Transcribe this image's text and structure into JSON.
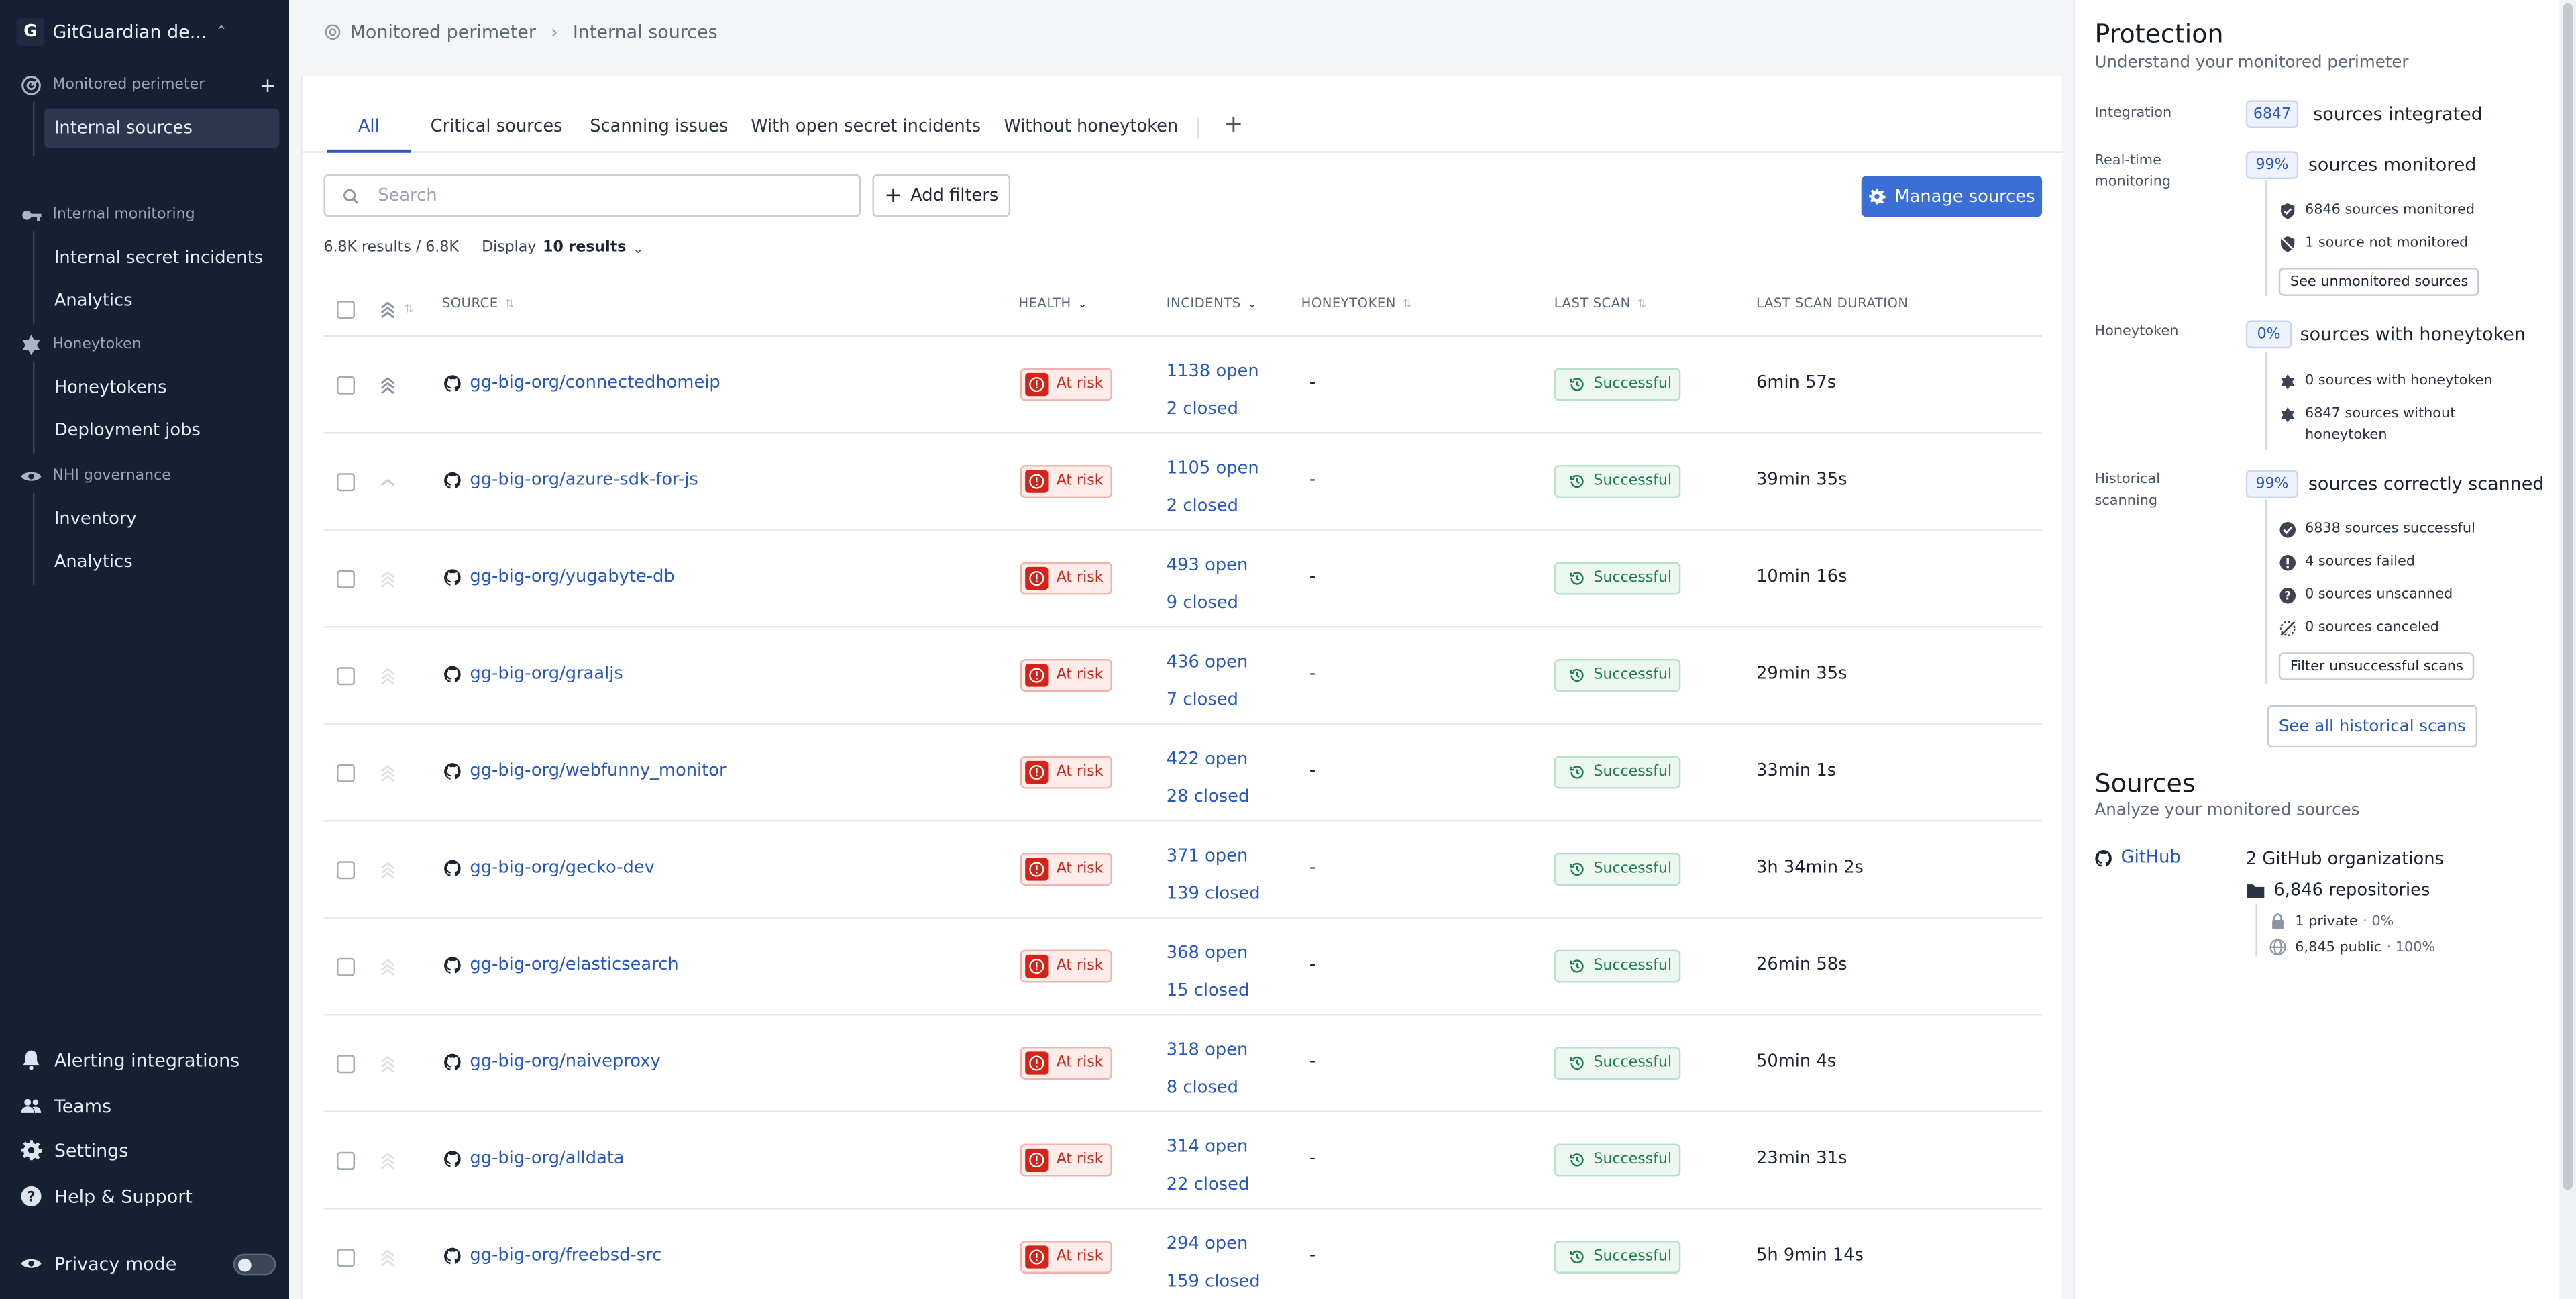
{
  "sidebar": {
    "org_initial": "G",
    "org_name": "GitGuardian de...",
    "sections": {
      "monitored": "Monitored perimeter",
      "internal": "Internal monitoring",
      "honeytoken": "Honeytoken",
      "nhi": "NHI governance"
    },
    "items": {
      "internal_sources": "Internal sources",
      "internal_secret_incidents": "Internal secret incidents",
      "analytics_1": "Analytics",
      "honeytokens": "Honeytokens",
      "deployment_jobs": "Deployment jobs",
      "inventory": "Inventory",
      "analytics_2": "Analytics"
    },
    "bottom": {
      "alerting": "Alerting integrations",
      "teams": "Teams",
      "settings": "Settings",
      "help": "Help & Support",
      "privacy": "Privacy mode"
    }
  },
  "breadcrumb": {
    "root": "Monitored perimeter",
    "current": "Internal sources"
  },
  "tabs": [
    "All",
    "Critical sources",
    "Scanning issues",
    "With open secret incidents",
    "Without honeytoken"
  ],
  "toolbar": {
    "search_placeholder": "Search",
    "add_filters": "Add filters",
    "manage_sources": "Manage sources"
  },
  "counts": {
    "results": "6.8K results",
    "total": "/ 6.8K",
    "display_label": "Display",
    "display_value": "10 results"
  },
  "columns": {
    "source": "SOURCE",
    "health": "HEALTH",
    "incidents": "INCIDENTS",
    "honeytoken": "HONEYTOKEN",
    "last_scan": "LAST SCAN",
    "last_scan_duration": "LAST SCAN DURATION"
  },
  "rows": [
    {
      "source": "gg-big-org/connectedhomeip",
      "health": "At risk",
      "open": "1138",
      "closed": "2",
      "honeytoken": "-",
      "last_scan": "Successful",
      "duration": "6min 57s"
    },
    {
      "source": "gg-big-org/azure-sdk-for-js",
      "health": "At risk",
      "open": "1105",
      "closed": "2",
      "honeytoken": "-",
      "last_scan": "Successful",
      "duration": "39min 35s"
    },
    {
      "source": "gg-big-org/yugabyte-db",
      "health": "At risk",
      "open": "493",
      "closed": "9",
      "honeytoken": "-",
      "last_scan": "Successful",
      "duration": "10min 16s"
    },
    {
      "source": "gg-big-org/graaljs",
      "health": "At risk",
      "open": "436",
      "closed": "7",
      "honeytoken": "-",
      "last_scan": "Successful",
      "duration": "29min 35s"
    },
    {
      "source": "gg-big-org/webfunny_monitor",
      "health": "At risk",
      "open": "422",
      "closed": "28",
      "honeytoken": "-",
      "last_scan": "Successful",
      "duration": "33min 1s"
    },
    {
      "source": "gg-big-org/gecko-dev",
      "health": "At risk",
      "open": "371",
      "closed": "139",
      "honeytoken": "-",
      "last_scan": "Successful",
      "duration": "3h 34min 2s"
    },
    {
      "source": "gg-big-org/elasticsearch",
      "health": "At risk",
      "open": "368",
      "closed": "15",
      "honeytoken": "-",
      "last_scan": "Successful",
      "duration": "26min 58s"
    },
    {
      "source": "gg-big-org/naiveproxy",
      "health": "At risk",
      "open": "318",
      "closed": "8",
      "honeytoken": "-",
      "last_scan": "Successful",
      "duration": "50min 4s"
    },
    {
      "source": "gg-big-org/alldata",
      "health": "At risk",
      "open": "314",
      "closed": "22",
      "honeytoken": "-",
      "last_scan": "Successful",
      "duration": "23min 31s"
    },
    {
      "source": "gg-big-org/freebsd-src",
      "health": "At risk",
      "open": "294",
      "closed": "159",
      "honeytoken": "-",
      "last_scan": "Successful",
      "duration": "5h 9min 14s"
    }
  ],
  "labels": {
    "open_suffix": "open",
    "closed_suffix": "closed"
  },
  "protection": {
    "title": "Protection",
    "subtitle": "Understand your monitored perimeter",
    "integration": {
      "label": "Integration",
      "value": "6847",
      "text": "sources integrated"
    },
    "realtime": {
      "label": "Real-time monitoring",
      "value": "99%",
      "text": "sources monitored",
      "monitored": "6846 sources monitored",
      "not_monitored": "1 source not monitored",
      "button": "See unmonitored sources"
    },
    "honeytoken": {
      "label": "Honeytoken",
      "value": "0%",
      "text": "sources with honeytoken",
      "with": "0 sources with honeytoken",
      "without": "6847 sources without honeytoken"
    },
    "historical": {
      "label": "Historical scanning",
      "value": "99%",
      "text": "sources correctly scanned",
      "successful": "6838 sources successful",
      "failed": "4 sources failed",
      "unscanned": "0 sources unscanned",
      "canceled": "0 sources canceled",
      "button": "Filter unsuccessful scans",
      "see_all": "See all historical scans"
    }
  },
  "sources_panel": {
    "title": "Sources",
    "subtitle": "Analyze your monitored sources",
    "provider": "GitHub",
    "orgs": "2 GitHub organizations",
    "repos": "6,846 repositories",
    "private": "1 private",
    "private_pct": "· 0%",
    "public": "6,845 public",
    "public_pct": "· 100%"
  },
  "colors": {
    "sidebar_bg": "#162033",
    "accent": "#3b6fd6",
    "link": "#2757c2",
    "risk": "#d6231a",
    "success": "#1f7d4e"
  }
}
